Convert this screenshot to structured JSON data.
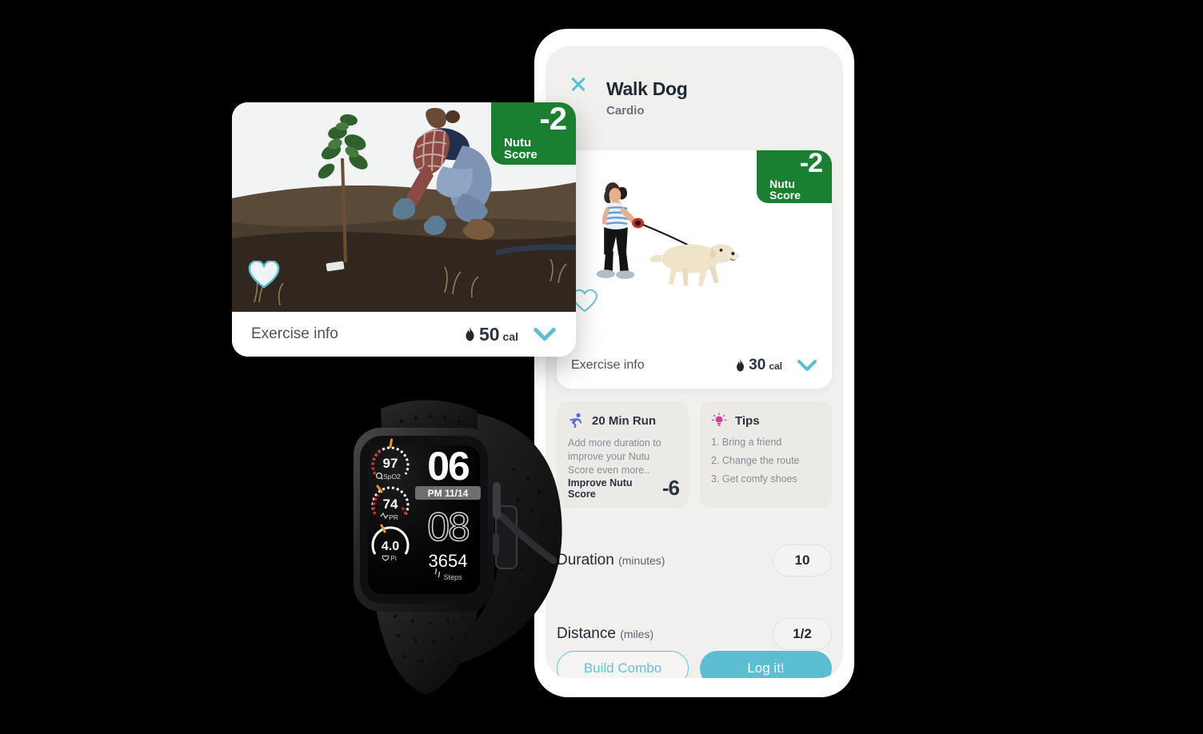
{
  "phone": {
    "close_icon": "close-icon",
    "title": "Walk Dog",
    "subtitle": "Cardio",
    "exercise_card": {
      "badge": {
        "value": "-2",
        "label": "Nutu Score"
      },
      "heart_icon": "heart-outline-icon",
      "footer_label": "Exercise info",
      "flame_icon": "flame-icon",
      "calories": "30",
      "calories_unit": "cal",
      "chevron_icon": "chevron-down-icon"
    },
    "tiles": [
      {
        "icon": "runner-icon",
        "title": "20 Min Run",
        "body": "Add more duration to improve your Nutu Score even more..",
        "foot_label": "Improve Nutu Score",
        "foot_value": "-6"
      },
      {
        "icon": "lightbulb-icon",
        "title": "Tips",
        "lines": [
          "1. Bring a friend",
          "2. Change the route",
          "3. Get comfy shoes"
        ]
      }
    ],
    "fields": [
      {
        "label": "Duration",
        "unit": "(minutes)",
        "value": "10"
      },
      {
        "label": "Distance",
        "unit": "(miles)",
        "value": "1/2"
      }
    ],
    "buttons": {
      "secondary": "Build Combo",
      "primary": "Log it!"
    }
  },
  "float_card": {
    "badge": {
      "value": "-2",
      "label": "Nutu Score"
    },
    "heart_icon": "heart-filled-icon",
    "footer_label": "Exercise info",
    "flame_icon": "flame-icon",
    "calories": "50",
    "calories_unit": "cal",
    "chevron_icon": "chevron-down-icon",
    "photo_alt": "woman planting a tree"
  },
  "watch": {
    "face": {
      "hour": "06",
      "minute": "08",
      "meridiem_date": "PM 11/14",
      "steps_value": "3654",
      "steps_label": "Steps",
      "steps_icon": "footsteps-icon",
      "gauges": [
        {
          "value": "97",
          "label": "SpO2",
          "icon": "spo2-icon"
        },
        {
          "value": "74",
          "label": "PR",
          "icon": "pulse-icon"
        },
        {
          "value": "4.0",
          "label": "Pi",
          "icon": "perfusion-icon"
        }
      ]
    }
  },
  "colors": {
    "badge_green": "#1b7f31",
    "accent_teal": "#5cbed1",
    "text_dark": "#1f2833",
    "text_muted": "#868d96",
    "runner_blue": "#5b6fd6",
    "bulb_pink": "#e0379b"
  }
}
